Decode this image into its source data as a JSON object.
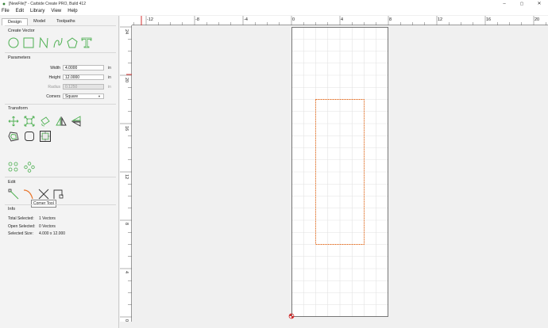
{
  "window": {
    "title": "[NewFile]* - Carbide Create PRO, Build 412",
    "minimize": "–",
    "maximize": "▢",
    "close": "✕"
  },
  "menu": {
    "file": "File",
    "edit": "Edit",
    "library": "Library",
    "view": "View",
    "help": "Help"
  },
  "tabs": {
    "design": "Design",
    "model": "Model",
    "toolpaths": "Toolpaths"
  },
  "create_vector": {
    "header": "Create Vector",
    "tools": [
      "circle-tool-icon",
      "rectangle-tool-icon",
      "polyline-tool-icon",
      "curve-tool-icon",
      "polygon-tool-icon",
      "text-tool-icon"
    ]
  },
  "parameters": {
    "header": "Parameters",
    "width_label": "Width",
    "width_value": "4.0000",
    "width_unit": "in",
    "height_label": "Height",
    "height_value": "12.0000",
    "height_unit": "in",
    "radius_label": "Radius",
    "radius_value": "0.1250",
    "radius_unit": "in",
    "corners_label": "Corners",
    "corners_value": "Square"
  },
  "transform": {
    "header": "Transform"
  },
  "edit": {
    "header": "Edit",
    "tooltip": "Corner Tool"
  },
  "info": {
    "header": "Info",
    "total_selected_label": "Total Selected:",
    "total_selected_value": "1 Vectors",
    "open_selected_label": "Open Selected:",
    "open_selected_value": "0 Vectors",
    "selected_size_label": "Selected Size:",
    "selected_size_value": "4.000 x 12.000"
  },
  "ruler": {
    "h_labels": [
      "-12",
      "-8",
      "-4",
      "0",
      "4",
      "8",
      "12",
      "16",
      "20"
    ],
    "v_labels": [
      "24",
      "20",
      "16",
      "12",
      "8",
      "4",
      "0"
    ]
  },
  "colors": {
    "icon_green": "#4caf50",
    "selection_orange": "#e8742a",
    "grid": "#e2e2e2",
    "stock_border": "#555555"
  }
}
